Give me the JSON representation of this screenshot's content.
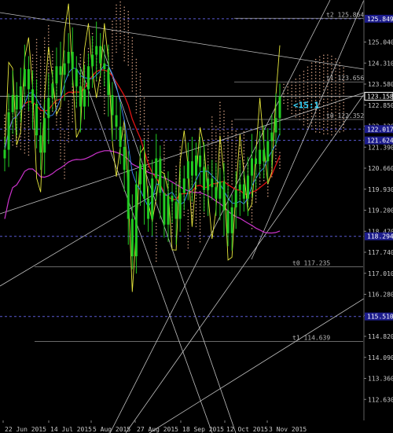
{
  "chart_data": {
    "type": "candlestick",
    "instrument_note": "",
    "ylim": [
      111.9,
      126.5
    ],
    "y_ticks": [
      "125.040",
      "124.310",
      "123.580",
      "122.850",
      "122.120",
      "121.390",
      "120.660",
      "119.930",
      "119.200",
      "118.470",
      "117.740",
      "117.010",
      "116.280",
      "115.550",
      "114.820",
      "114.090",
      "113.360",
      "112.630"
    ],
    "x_ticks": [
      "22 Jun 2015",
      "14 Jul 2015",
      "5 Aug 2015",
      "27 Aug 2015",
      "18 Sep 2015",
      "12 Oct 2015",
      "3 Nov 2015"
    ],
    "price_badges": [
      {
        "text": "125.849",
        "value": 125.849,
        "kind": "level"
      },
      {
        "text": "123.158",
        "value": 123.158,
        "kind": "current"
      },
      {
        "text": "122.017",
        "value": 122.017,
        "kind": "level"
      },
      {
        "text": "121.624",
        "value": 121.624,
        "kind": "level"
      },
      {
        "text": "118.294",
        "value": 118.294,
        "kind": "level"
      },
      {
        "text": "115.510",
        "value": 115.51,
        "kind": "level"
      }
    ],
    "level_labels": [
      {
        "text": "t2 125.864",
        "value": 125.864
      },
      {
        "text": "t1 123.656",
        "value": 123.656
      },
      {
        "text": "t0 122.352",
        "value": 122.352
      },
      {
        "text": "t0 117.235",
        "value": 117.235
      },
      {
        "text": "t1 114.639",
        "value": 114.639
      }
    ],
    "annotation": "<15:1",
    "series": [
      {
        "kind": "close",
        "color": "#22cc22",
        "values": [
          121.3,
          122.6,
          123.2,
          122.7,
          123.5,
          124.1,
          123.4,
          122.9,
          121.8,
          121.2,
          122.4,
          123.1,
          123.6,
          124.2,
          123.9,
          124.3,
          124.7,
          124.1,
          123.5,
          122.8,
          123.4,
          124.2,
          124.6,
          124.9,
          124.3,
          124.1,
          123.2,
          122.5,
          122.1,
          121.4,
          120.6,
          118.9,
          117.6,
          120.1,
          120.8,
          119.6,
          118.9,
          120.3,
          121.0,
          119.8,
          118.7,
          119.7,
          119.5,
          118.9,
          119.8,
          120.3,
          120.9,
          120.4,
          121.1,
          120.7,
          119.9,
          120.3,
          120.0,
          119.6,
          120.2,
          119.2,
          118.4,
          119.3,
          119.9,
          120.1,
          119.6,
          120.4,
          121.0,
          120.8,
          121.3,
          120.9,
          121.6,
          121.9,
          122.4,
          123.15
        ]
      },
      {
        "kind": "ma_red",
        "color": "#e01414"
      },
      {
        "kind": "ma_magenta",
        "color": "#cc33cc"
      },
      {
        "kind": "tenkan_yellow",
        "color": "#e6e63c"
      },
      {
        "kind": "kijun_blue",
        "color": "#3c8cff"
      },
      {
        "kind": "cloud",
        "color": "#c8967a"
      }
    ],
    "grid": false,
    "colors": {
      "background": "#000000",
      "candle_up": "#22cc22",
      "badge": "#1c1c8c"
    }
  }
}
